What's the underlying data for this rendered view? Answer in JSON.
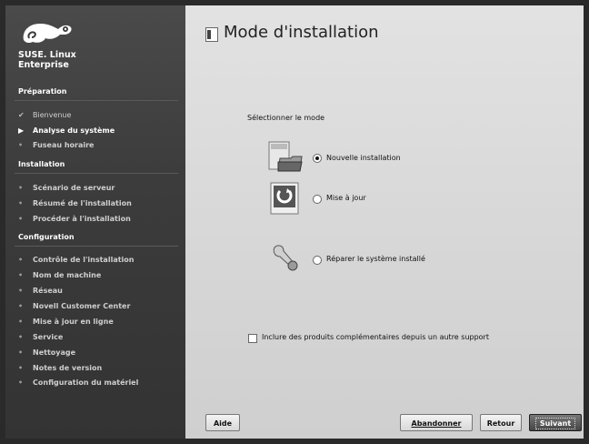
{
  "sidebar": {
    "brand_line1": "SUSE. Linux",
    "brand_line2": "Enterprise",
    "sections": [
      {
        "title": "Préparation"
      },
      {
        "title": "Installation"
      },
      {
        "title": "Configuration"
      }
    ],
    "prep_items": [
      {
        "label": "Bienvenue",
        "state": "done",
        "marker": "✔"
      },
      {
        "label": "Analyse du système",
        "state": "current",
        "marker": "▶"
      },
      {
        "label": "Fuseau horaire",
        "state": "todo",
        "marker": "•"
      }
    ],
    "install_items": [
      {
        "label": "Scénario de serveur",
        "marker": "•"
      },
      {
        "label": "Résumé de l'installation",
        "marker": "•"
      },
      {
        "label": "Procéder à l'installation",
        "marker": "•"
      }
    ],
    "config_items": [
      {
        "label": "Contrôle de l'installation",
        "marker": "•"
      },
      {
        "label": "Nom de machine",
        "marker": "•"
      },
      {
        "label": "Réseau",
        "marker": "•"
      },
      {
        "label": "Novell Customer Center",
        "marker": "•"
      },
      {
        "label": "Mise à jour en ligne",
        "marker": "•"
      },
      {
        "label": "Service",
        "marker": "•"
      },
      {
        "label": "Nettoyage",
        "marker": "•"
      },
      {
        "label": "Notes de version",
        "marker": "•"
      },
      {
        "label": "Configuration du matériel",
        "marker": "•"
      }
    ]
  },
  "main": {
    "title": "Mode d'installation",
    "prompt": "Sélectionner le mode",
    "options": [
      {
        "label": "Nouvelle installation",
        "selected": true
      },
      {
        "label": "Mise à jour",
        "selected": false
      },
      {
        "label": "Réparer le système installé",
        "selected": false
      }
    ],
    "addon_checkbox": {
      "label": "Inclure des produits complémentaires depuis un autre support",
      "checked": false
    }
  },
  "buttons": {
    "help": "Aide",
    "abort": "Abandonner",
    "back": "Retour",
    "next": "Suivant"
  }
}
